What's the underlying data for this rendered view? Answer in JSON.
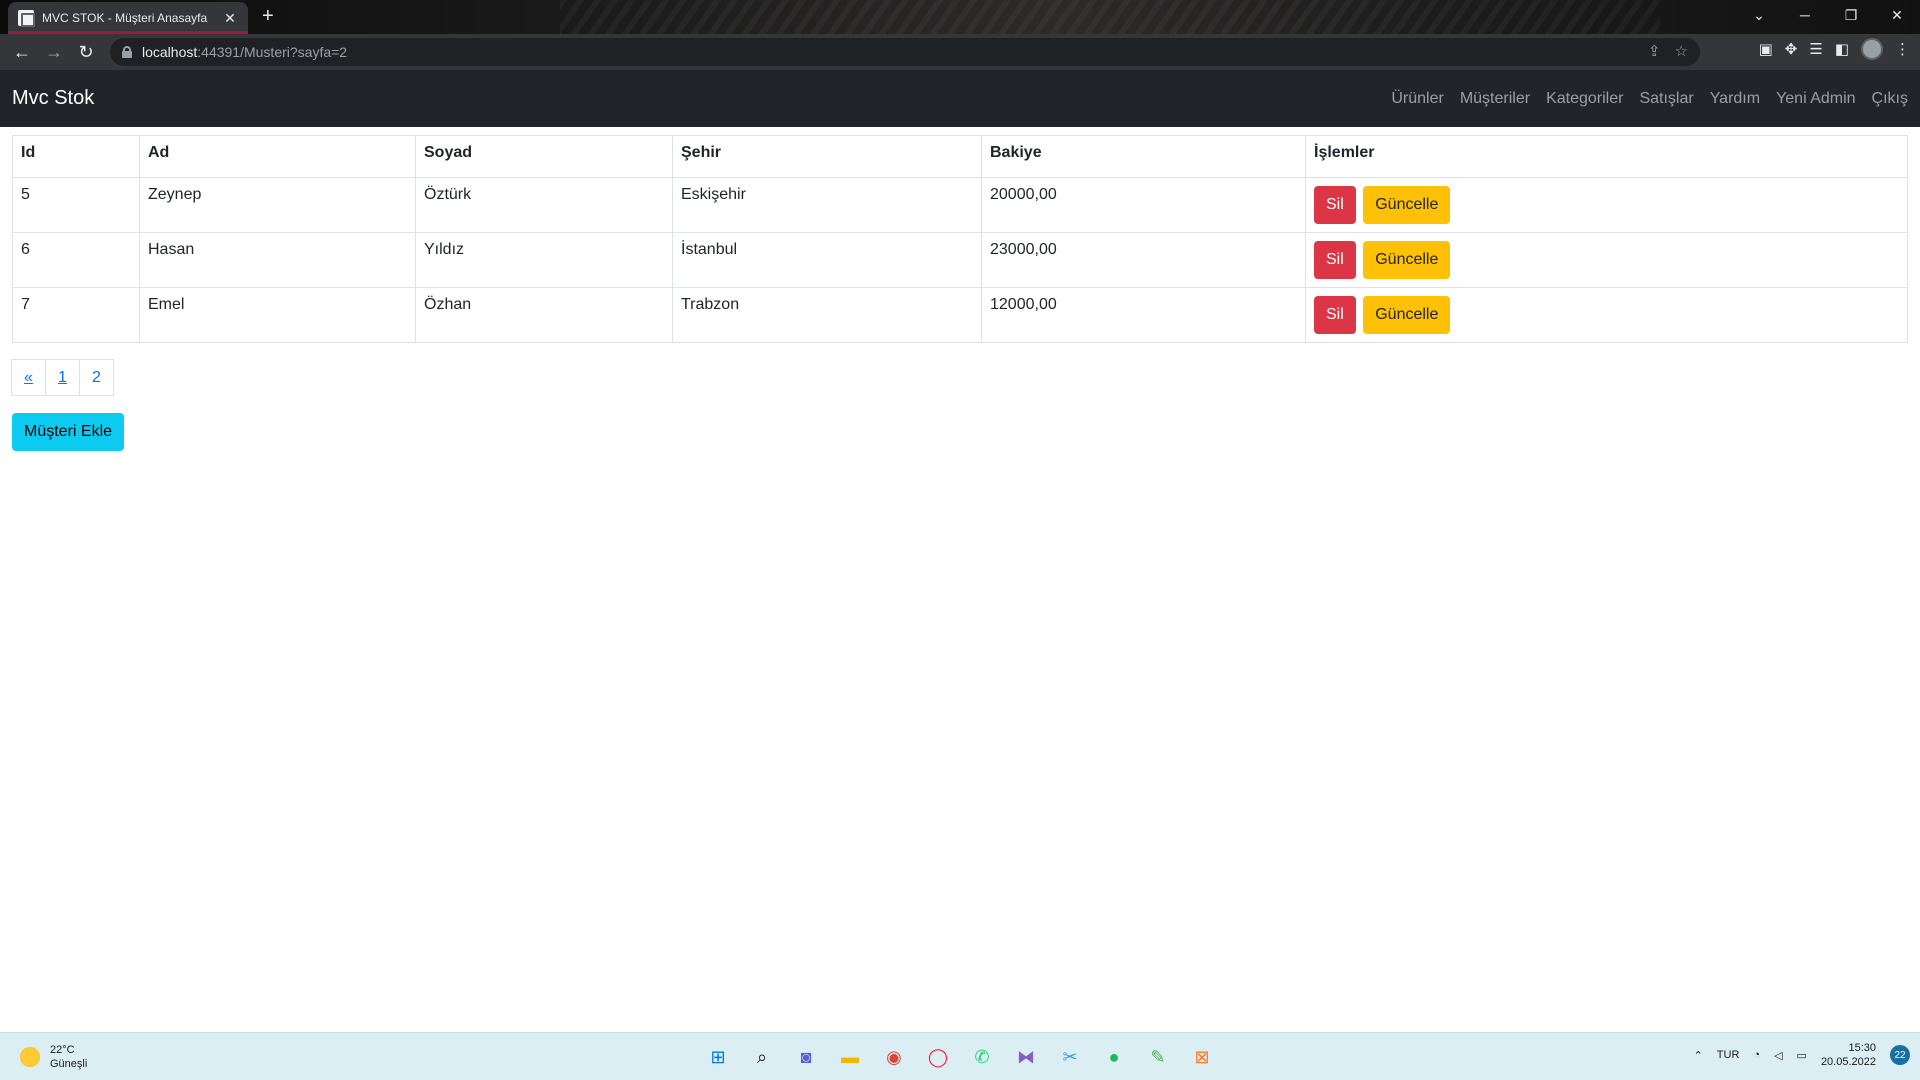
{
  "browser": {
    "tab_title": "MVC STOK - Müşteri Anasayfa",
    "url_host": "localhost",
    "url_path": ":44391/Musteri?sayfa=2"
  },
  "navbar": {
    "brand": "Mvc Stok",
    "links": [
      "Ürünler",
      "Müşteriler",
      "Kategoriler",
      "Satışlar",
      "Yardım",
      "Yeni Admin",
      "Çıkış"
    ]
  },
  "table": {
    "headers": [
      "Id",
      "Ad",
      "Soyad",
      "Şehir",
      "Bakiye",
      "İşlemler"
    ],
    "rows": [
      {
        "id": "5",
        "ad": "Zeynep",
        "soyad": "Öztürk",
        "sehir": "Eskişehir",
        "bakiye": "20000,00"
      },
      {
        "id": "6",
        "ad": "Hasan",
        "soyad": "Yıldız",
        "sehir": "İstanbul",
        "bakiye": "23000,00"
      },
      {
        "id": "7",
        "ad": "Emel",
        "soyad": "Özhan",
        "sehir": "Trabzon",
        "bakiye": "12000,00"
      }
    ],
    "delete_label": "Sil",
    "update_label": "Güncelle"
  },
  "pagination": [
    "«",
    "1",
    "2"
  ],
  "add_button": "Müşteri Ekle",
  "taskbar": {
    "temperature": "22°C",
    "weather": "Güneşli",
    "language": "TUR",
    "time": "15:30",
    "date": "20.05.2022",
    "notifications": "22"
  },
  "colors": {
    "danger": "#dc3545",
    "warning": "#ffc107",
    "info": "#0dcaf0",
    "navbar": "#212529",
    "link": "#0d6efd"
  }
}
